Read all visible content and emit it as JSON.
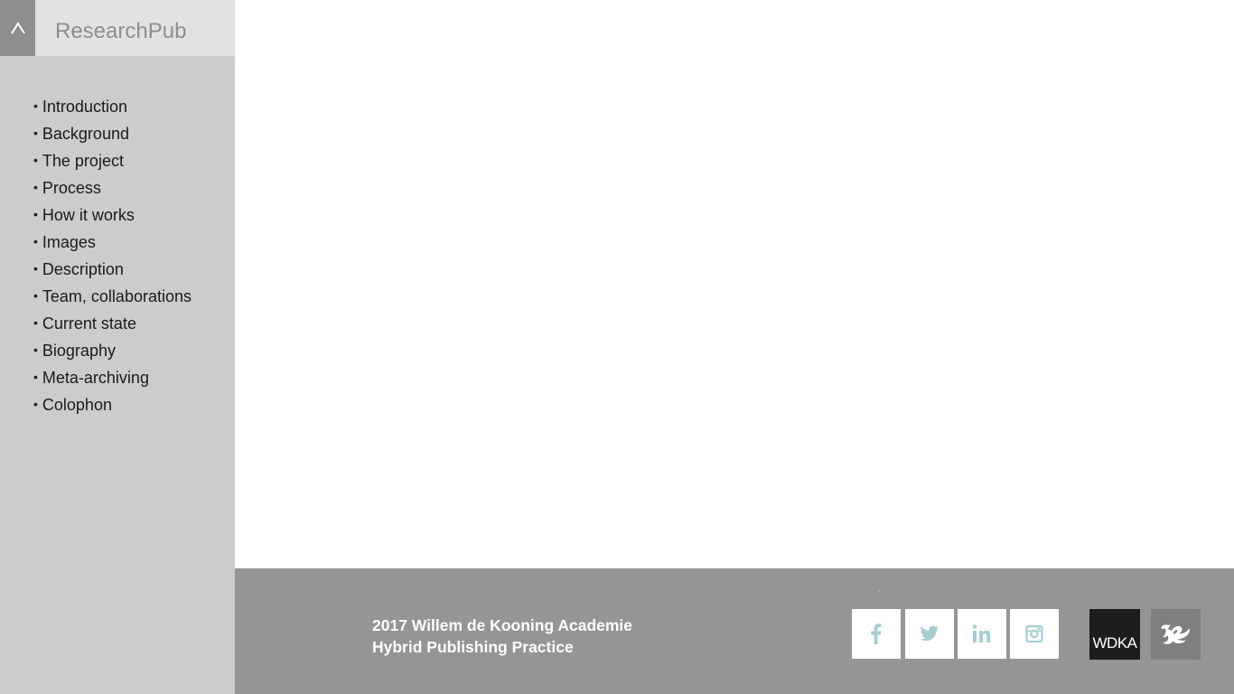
{
  "site": {
    "title": "ResearchPub",
    "up_icon": "caret-up-icon"
  },
  "toc": {
    "bullet": "•",
    "items": [
      {
        "label": "Introduction"
      },
      {
        "label": "Background"
      },
      {
        "label": "The project"
      },
      {
        "label": "Process"
      },
      {
        "label": "How it works"
      },
      {
        "label": "Images"
      },
      {
        "label": "Description"
      },
      {
        "label": "Team, collaborations"
      },
      {
        "label": "Current state"
      },
      {
        "label": "Biography"
      },
      {
        "label": "Meta-archiving"
      },
      {
        "label": "Colophon"
      }
    ]
  },
  "footer": {
    "line1": "2017 Willem de Kooning Academie",
    "line2": "Hybrid Publishing Practice",
    "social_icons": [
      "facebook-icon",
      "twitter-icon",
      "linkedin-icon",
      "instagram-icon"
    ],
    "icon_color": "#a7cfd1",
    "logos": {
      "wdka": "WDKA",
      "hr_logo_name": "hogeschool-rotterdam-logo"
    }
  },
  "colors": {
    "sidebar_bg": "#cccccc",
    "header_bg": "#e2e2e2",
    "up_button_bg": "#8e8e8e",
    "footer_bg": "#959595"
  }
}
